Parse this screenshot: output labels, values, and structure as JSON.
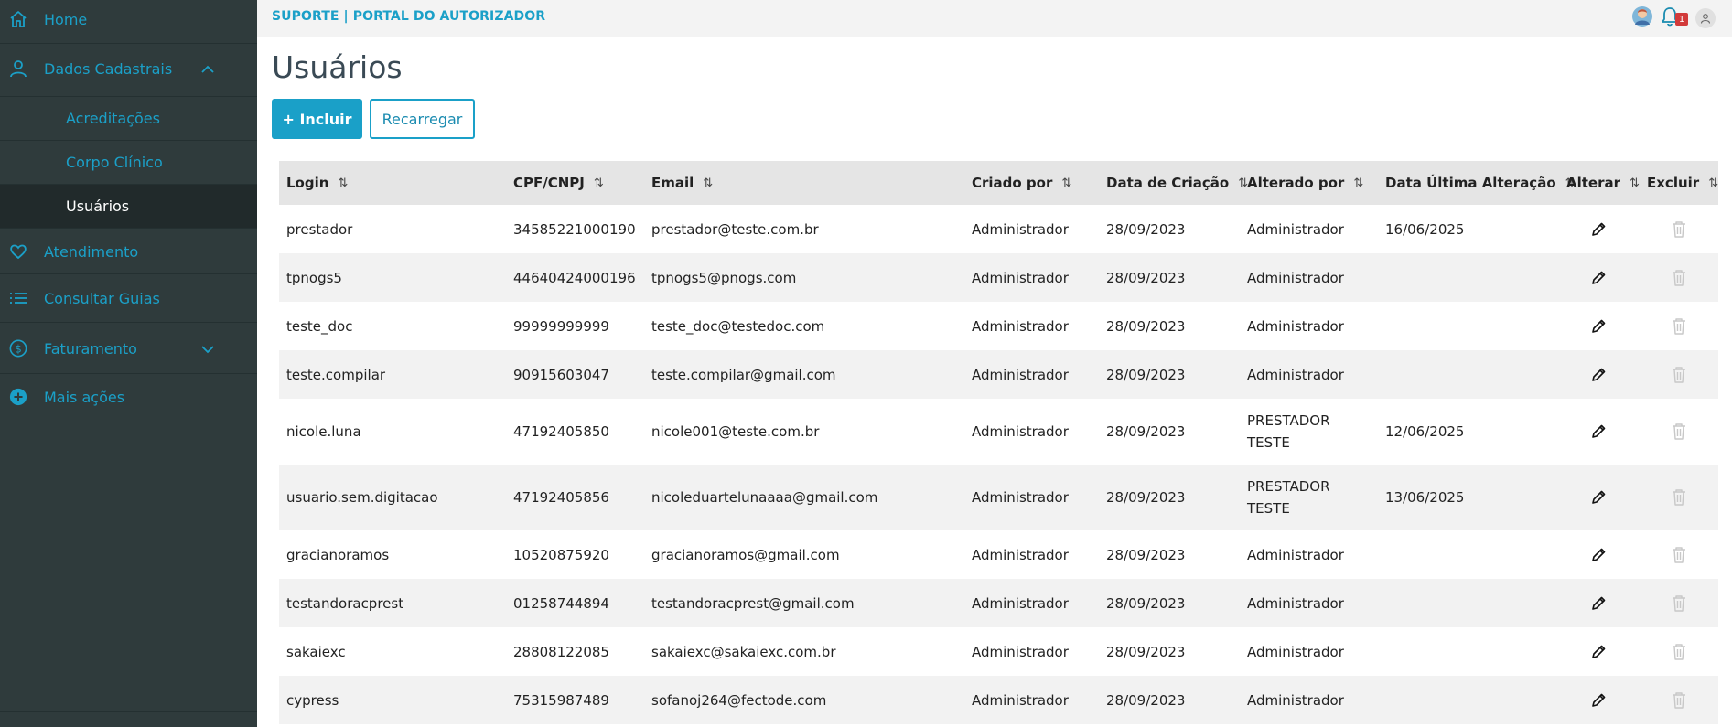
{
  "sidebar": {
    "home": "Home",
    "dados_cadastrais": "Dados Cadastrais",
    "sub": [
      "Acreditações",
      "Corpo Clínico",
      "Usuários"
    ],
    "atendimento": "Atendimento",
    "consultar_guias": "Consultar Guias",
    "faturamento": "Faturamento",
    "mais_acoes": "Mais ações"
  },
  "topbar": {
    "brand": "SUPORTE | PORTAL DO AUTORIZADOR",
    "notification_count": "1"
  },
  "page": {
    "title": "Usuários",
    "add_label": "+ Incluir",
    "reload_label": "Recarregar"
  },
  "table": {
    "headers": [
      "Login",
      "CPF/CNPJ",
      "Email",
      "Criado por",
      "Data de Criação",
      "Alterado por",
      "Data Última Alteração",
      "Alterar",
      "Excluir"
    ],
    "sort_icon": "⇅",
    "rows": [
      {
        "login": "prestador",
        "doc": "34585221000190",
        "email": "prestador@teste.com.br",
        "created_by": "Administrador",
        "created_at": "28/09/2023",
        "changed_by": "Administrador",
        "changed_at": "16/06/2025"
      },
      {
        "login": "tpnogs5",
        "doc": "44640424000196",
        "email": "tpnogs5@pnogs.com",
        "created_by": "Administrador",
        "created_at": "28/09/2023",
        "changed_by": "Administrador",
        "changed_at": ""
      },
      {
        "login": "teste_doc",
        "doc": "99999999999",
        "email": "teste_doc@testedoc.com",
        "created_by": "Administrador",
        "created_at": "28/09/2023",
        "changed_by": "Administrador",
        "changed_at": ""
      },
      {
        "login": "teste.compilar",
        "doc": "90915603047",
        "email": "teste.compilar@gmail.com",
        "created_by": "Administrador",
        "created_at": "28/09/2023",
        "changed_by": "Administrador",
        "changed_at": ""
      },
      {
        "login": "nicole.luna",
        "doc": "47192405850",
        "email": "nicole001@teste.com.br",
        "created_by": "Administrador",
        "created_at": "28/09/2023",
        "changed_by": "PRESTADOR TESTE",
        "changed_at": "12/06/2025"
      },
      {
        "login": "usuario.sem.digitacao",
        "doc": "47192405856",
        "email": "nicoleduartelunaaaa@gmail.com",
        "created_by": "Administrador",
        "created_at": "28/09/2023",
        "changed_by": "PRESTADOR TESTE",
        "changed_at": "13/06/2025"
      },
      {
        "login": "gracianoramos",
        "doc": "10520875920",
        "email": "gracianoramos@gmail.com",
        "created_by": "Administrador",
        "created_at": "28/09/2023",
        "changed_by": "Administrador",
        "changed_at": ""
      },
      {
        "login": "testandoracprest",
        "doc": "01258744894",
        "email": "testandoracprest@gmail.com",
        "created_by": "Administrador",
        "created_at": "28/09/2023",
        "changed_by": "Administrador",
        "changed_at": ""
      },
      {
        "login": "sakaiexc",
        "doc": "28808122085",
        "email": "sakaiexc@sakaiexc.com.br",
        "created_by": "Administrador",
        "created_at": "28/09/2023",
        "changed_by": "Administrador",
        "changed_at": ""
      },
      {
        "login": "cypress",
        "doc": "75315987489",
        "email": "sofanoj264@fectode.com",
        "created_by": "Administrador",
        "created_at": "28/09/2023",
        "changed_by": "Administrador",
        "changed_at": ""
      }
    ]
  },
  "colors": {
    "sidebar_bg": "#2f3b3c",
    "accent": "#1aa0c8",
    "active_bg": "#212a2b"
  },
  "icons": {
    "home": "home-icon",
    "user": "user-icon",
    "heart": "heart-icon",
    "list": "list-icon",
    "dollar": "dollar-icon",
    "plus": "plus-circle-icon",
    "edit": "pencil-icon",
    "delete": "trash-icon"
  }
}
